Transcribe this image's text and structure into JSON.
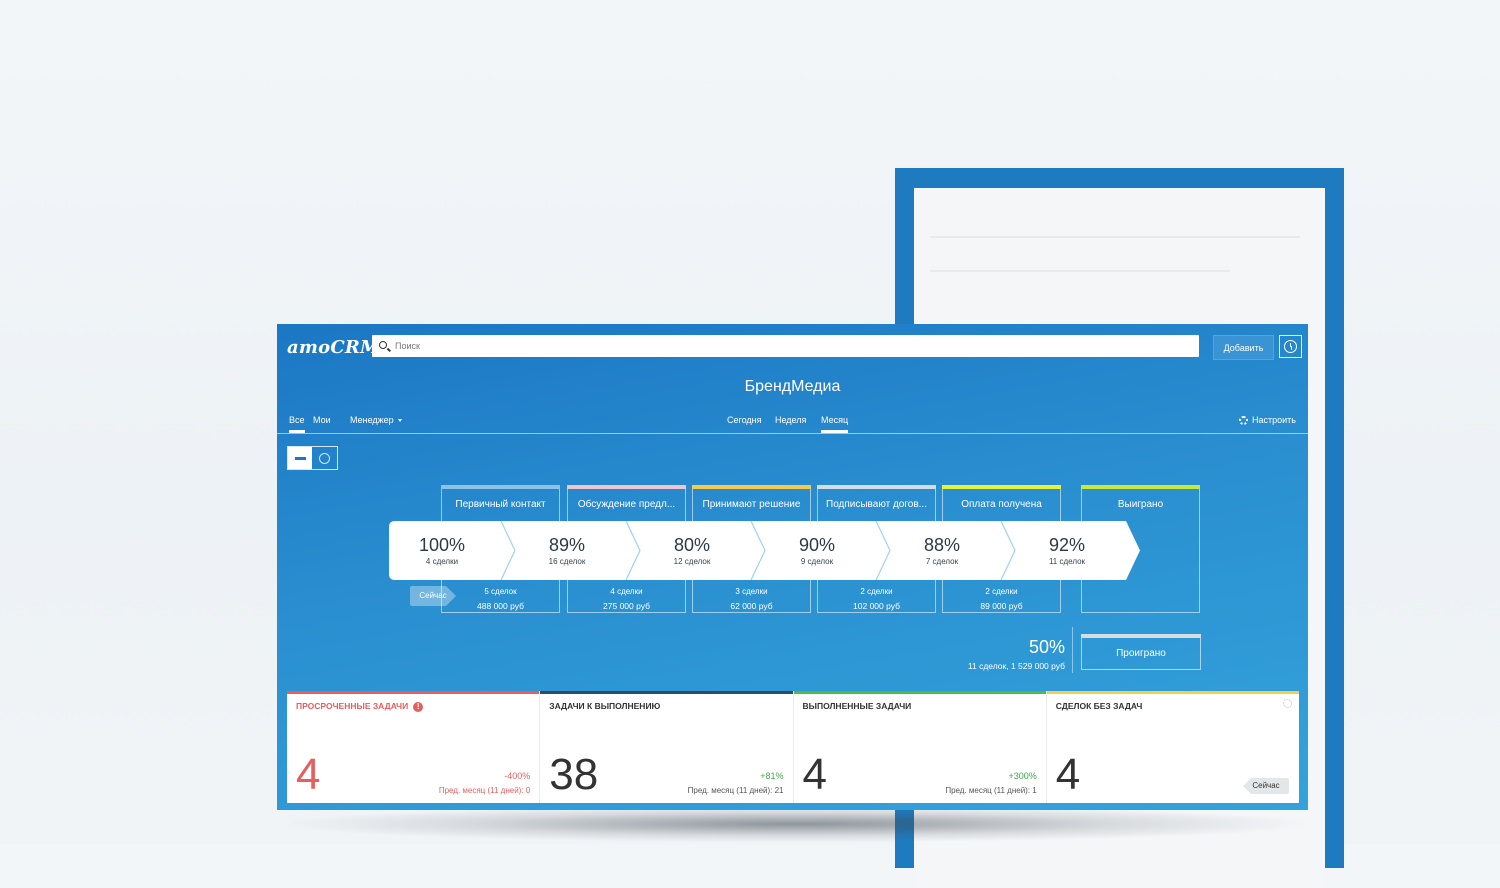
{
  "app": {
    "logo": "amoCRM.",
    "search_placeholder": "Поиск",
    "add_label": "Добавить",
    "title": "БрендМедиа"
  },
  "nav": {
    "filters": [
      "Все",
      "Мои"
    ],
    "manager_label": "Менеджер",
    "periods": [
      "Сегодня",
      "Неделя",
      "Месяц"
    ],
    "active_period": "Месяц",
    "settings_label": "Настроить"
  },
  "pipeline": {
    "stages": [
      {
        "label": "Первичный контакт",
        "color": "#8fc2e6",
        "count": "5 сделок",
        "sum": "488 000 руб"
      },
      {
        "label": "Обсуждение предл...",
        "color": "#f2c4d0",
        "count": "4 сделки",
        "sum": "275 000 руб"
      },
      {
        "label": "Принимают решение",
        "color": "#f7c94d",
        "count": "3 сделки",
        "sum": "62 000 руб"
      },
      {
        "label": "Подписывают догов...",
        "color": "#d5dde3",
        "count": "2 сделки",
        "sum": "102 000 руб"
      },
      {
        "label": "Оплата получена",
        "color": "#e8f23a",
        "count": "2 сделки",
        "sum": "89 000 руб"
      },
      {
        "label": "Выиграно",
        "color": "#c8e83a",
        "count": "",
        "sum": ""
      }
    ],
    "conversions": [
      {
        "pct": "100%",
        "sub": "4 сделки"
      },
      {
        "pct": "89%",
        "sub": "16 сделок"
      },
      {
        "pct": "80%",
        "sub": "12 сделок"
      },
      {
        "pct": "90%",
        "sub": "9 сделок"
      },
      {
        "pct": "88%",
        "sub": "7 сделок"
      },
      {
        "pct": "92%",
        "sub": "11 сделок"
      }
    ],
    "now_label": "Сейчас",
    "lost": {
      "pct": "50%",
      "sum": "11 сделок, 1 529 000 руб",
      "label": "Проиграно"
    }
  },
  "widgets": [
    {
      "title": "ПРОСРОЧЕННЫЕ ЗАДАЧИ",
      "value": "4",
      "delta": "-400%",
      "prev": "Пред. месяц (11 дней): 0",
      "bar_color": "#e65e5e",
      "title_color": "#e65e5e",
      "value_color": "#e65e5e",
      "delta_color": "#e65e5e"
    },
    {
      "title": "ЗАДАЧИ К ВЫПОЛНЕНИЮ",
      "value": "38",
      "delta": "+81%",
      "prev": "Пред. месяц (11 дней): 21",
      "bar_color": "#2f4a6b",
      "title_color": "#333333",
      "value_color": "#333333",
      "delta_color": "#3aa84a"
    },
    {
      "title": "ВЫПОЛНЕННЫЕ ЗАДАЧИ",
      "value": "4",
      "delta": "+300%",
      "prev": "Пред. месяц (11 дней): 1",
      "bar_color": "#4cbb4c",
      "title_color": "#333333",
      "value_color": "#333333",
      "delta_color": "#3aa84a"
    },
    {
      "title": "СДЕЛОК БЕЗ ЗАДАЧ",
      "value": "4",
      "now_label": "Сейчас",
      "bar_color": "#f2d14a",
      "title_color": "#333333",
      "value_color": "#333333"
    }
  ]
}
